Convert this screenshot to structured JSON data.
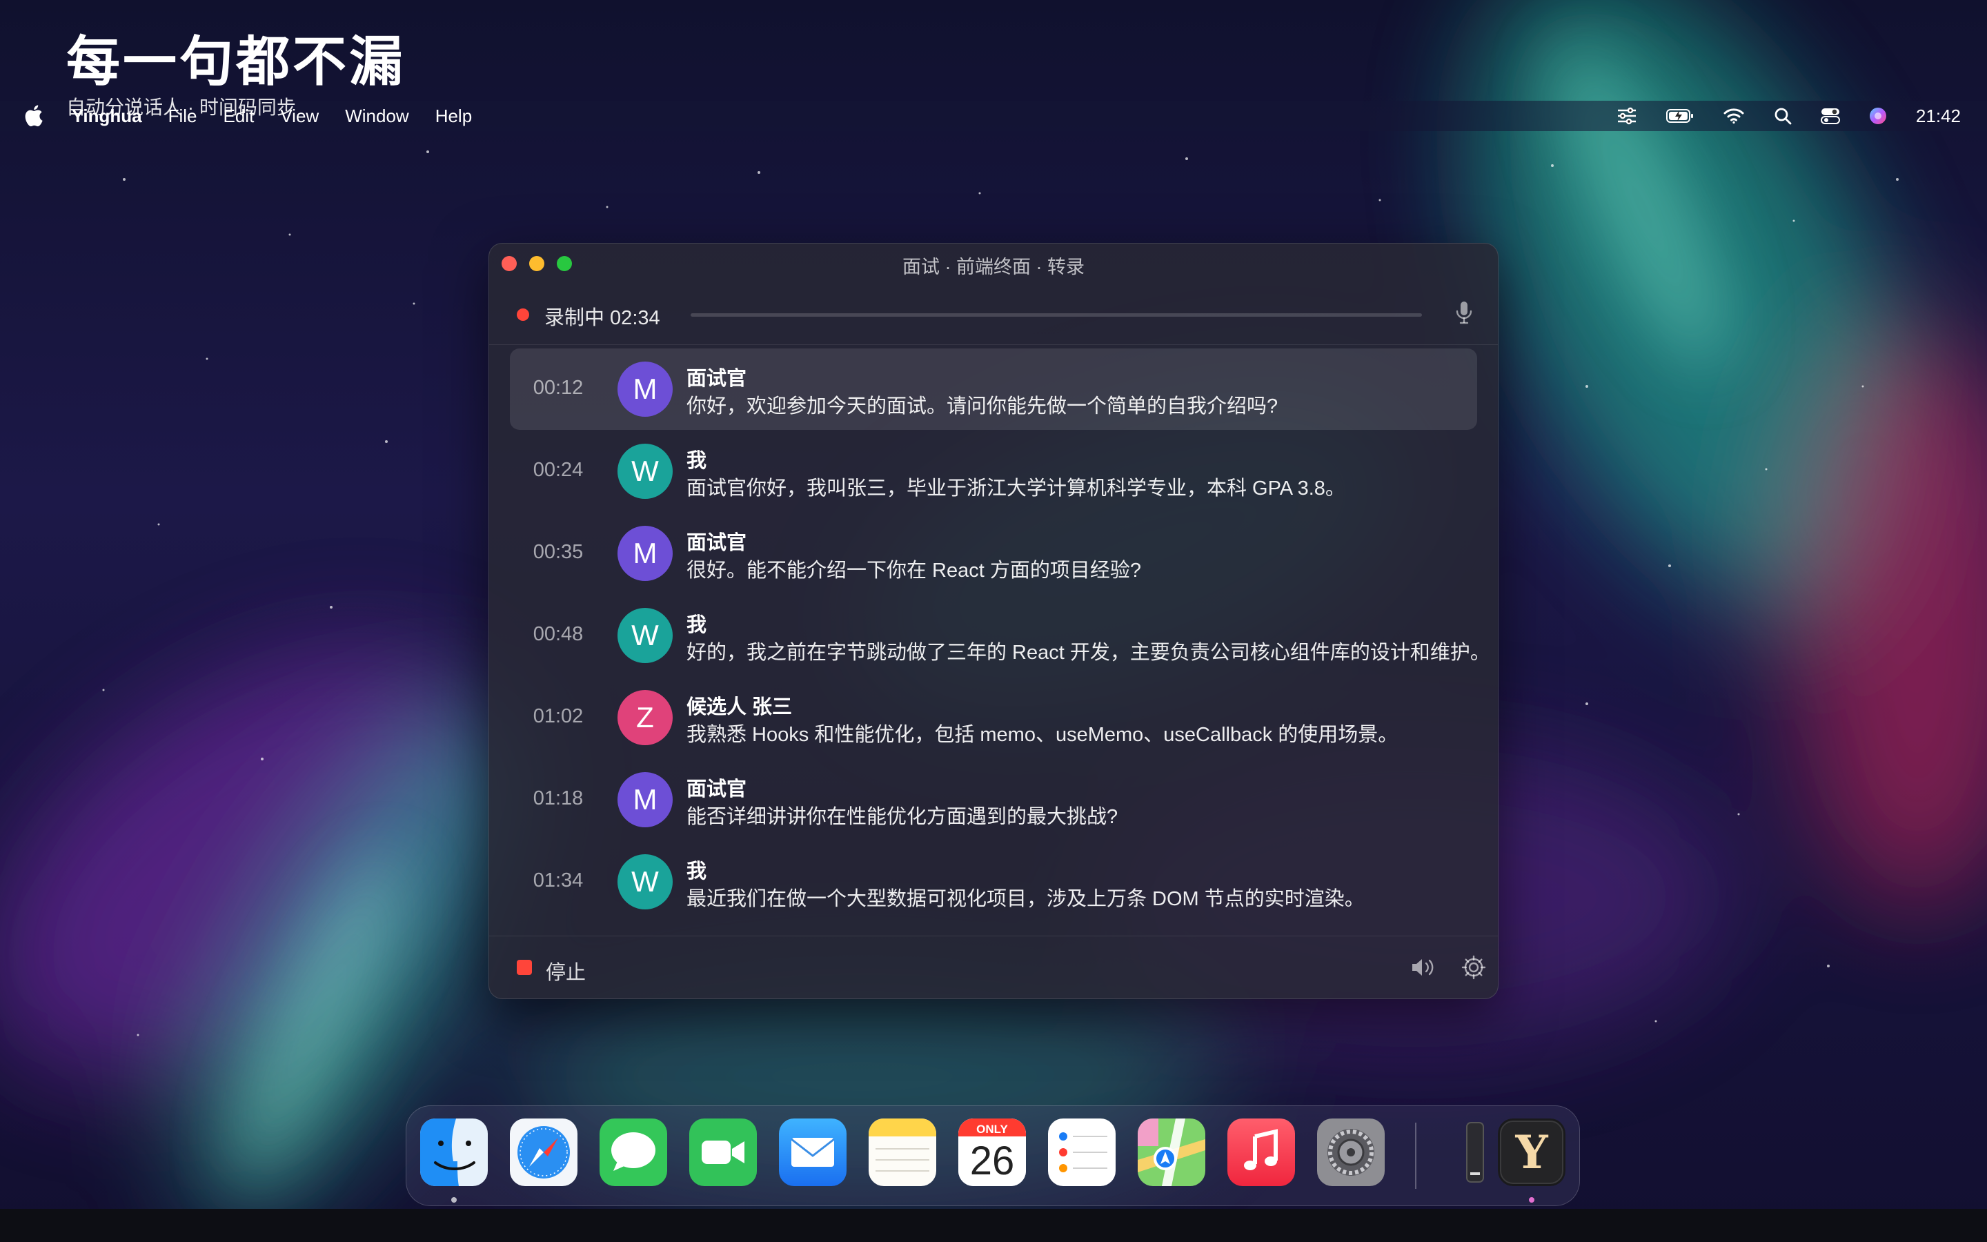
{
  "overlay": {
    "headline": "每一句都不漏",
    "subtitle": "自动分说话人 · 时间码同步"
  },
  "menubar": {
    "app_name": "Yinghua",
    "items": [
      "File",
      "Edit",
      "View",
      "Window",
      "Help"
    ],
    "clock": "21:42"
  },
  "window": {
    "title": "面试 · 前端终面 · 转录",
    "recording": {
      "label": "录制中 02:34"
    },
    "footer": {
      "stop_label": "停止"
    }
  },
  "speakers": {
    "interviewer": {
      "name": "面试官",
      "initial": "M",
      "color": "#6d4fd6"
    },
    "me": {
      "name": "我",
      "initial": "W",
      "color": "#1aa39a"
    },
    "candidate": {
      "name": "候选人 张三",
      "initial": "Z",
      "color": "#e0427a"
    }
  },
  "transcript": [
    {
      "time": "00:12",
      "speaker": "面试官",
      "initial": "M",
      "text": "你好，欢迎参加今天的面试。请问你能先做一个简单的自我介绍吗?"
    },
    {
      "time": "00:24",
      "speaker": "我",
      "initial": "W",
      "text": "面试官你好，我叫张三，毕业于浙江大学计算机科学专业，本科 GPA 3.8。"
    },
    {
      "time": "00:35",
      "speaker": "面试官",
      "initial": "M",
      "text": "很好。能不能介绍一下你在 React 方面的项目经验?"
    },
    {
      "time": "00:48",
      "speaker": "我",
      "initial": "W",
      "text": "好的，我之前在字节跳动做了三年的 React 开发，主要负责公司核心组件库的设计和维护。"
    },
    {
      "time": "01:02",
      "speaker": "候选人 张三",
      "initial": "Z",
      "text": "我熟悉 Hooks 和性能优化，包括 memo、useMemo、useCallback 的使用场景。"
    },
    {
      "time": "01:18",
      "speaker": "面试官",
      "initial": "M",
      "text": "能否详细讲讲你在性能优化方面遇到的最大挑战?"
    },
    {
      "time": "01:34",
      "speaker": "我",
      "initial": "W",
      "text": "最近我们在做一个大型数据可视化项目，涉及上万条 DOM 节点的实时渲染。"
    }
  ],
  "dock": {
    "calendar": {
      "month": "ONLY",
      "day": "26"
    },
    "yinghua_letter": "Y"
  }
}
